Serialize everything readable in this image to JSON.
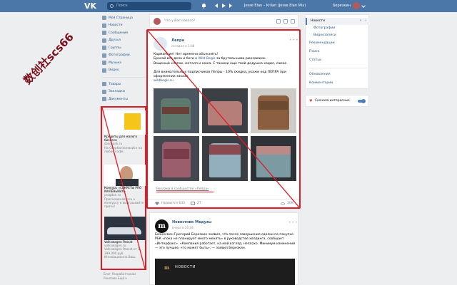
{
  "header": {
    "logo_text": "VK",
    "search_placeholder": "Поиск",
    "track": "Jesse Elan – Krilan (Jesse Elan Mix)",
    "user_name": "Березкин"
  },
  "left_nav": {
    "items": [
      {
        "label": "Моя Страница",
        "icon": "home-icon"
      },
      {
        "label": "Новости",
        "icon": "news-icon"
      },
      {
        "label": "Сообщения",
        "icon": "messages-icon"
      },
      {
        "label": "Друзья",
        "icon": "friends-icon"
      },
      {
        "label": "Группы",
        "icon": "groups-icon"
      },
      {
        "label": "Фотографии",
        "icon": "photos-icon"
      },
      {
        "label": "Музыка",
        "icon": "music-icon"
      },
      {
        "label": "Видео",
        "icon": "video-icon"
      }
    ],
    "items2": [
      {
        "label": "Товары",
        "icon": "goods-icon"
      },
      {
        "label": "Закладки",
        "icon": "bookmarks-icon"
      },
      {
        "label": "Документы",
        "icon": "documents-icon"
      }
    ]
  },
  "left_ads": [
    {
      "title": "Кредиты для малого бизнеса",
      "source": "sberbank.ru",
      "desc": "На Сбербанкинвойсе на любое кафе."
    },
    {
      "title": "Конкурс «СЕКРЕТЫ PRO МАЛЕНЬКИХ»",
      "source": "progdan.ru",
      "desc": "Присоединяйтесь к конкурсу и выигрывайте призы!"
    },
    {
      "title": "Volkswagen Passat",
      "source": "volkswagen.ru",
      "desc": "Volkswagen Passat от 1 399 000 руб. Инновационно Ваш."
    }
  ],
  "footer": {
    "l1": "Блог   Разработчикам",
    "l2": "Реклама   Ещё ▾"
  },
  "composer": {
    "placeholder": "Что у Вас нового?"
  },
  "post1": {
    "author": "Лепра",
    "date": "сегодня в 1:08",
    "p1": "Кармамкин! Нет времени объяснять!",
    "p2a": "Бросай все дела и беги к ",
    "p2link": "Wild Begis",
    "p2b": " за брутальными рюкзаками.",
    "p3": "Вощеный хлопок, металл и кожа. С такими еще твой дедушка ходил, самое.",
    "p4": "Для внимательных подписчиков Лепры - 10% скидка, укажи код ЛЕПРА при оформлении заказа.",
    "p4link": "wildbegis.ru",
    "ad_label": "Реклама в сообществе «Лепра»",
    "likes_label": "Нравится",
    "likes": "633",
    "shares": "27",
    "views": "30K"
  },
  "post2": {
    "author": "Новостник Медузы",
    "date": "вчера в 20:44",
    "text": "Бизнесмен Григорий Березкин заявил, что после завершения сделки по покупке РБК «пока не планирует много менять» в руководстве холдинга, сообщает «Интерфакс». «Компания работает, на мой взгляд, неплохо. Минимум изменений — это лучшее, что может быть», — заявил Березкин.",
    "banner_logo": "m",
    "banner_text": "НОВОСТИ"
  },
  "right_menu": {
    "selected": "Новости",
    "sub": [
      "Фотографии",
      "Видеозаписи"
    ],
    "items": [
      "Рекомендации",
      "Поиск",
      "Статьи"
    ],
    "items2": [
      "Обновления",
      "Комментарии"
    ]
  },
  "right_setting": {
    "label": "Сначала интересные"
  },
  "watermark": "数创社scs66",
  "colors": {
    "header": "#4a76a8",
    "link": "#2a5885",
    "annotation": "#e01b24"
  }
}
